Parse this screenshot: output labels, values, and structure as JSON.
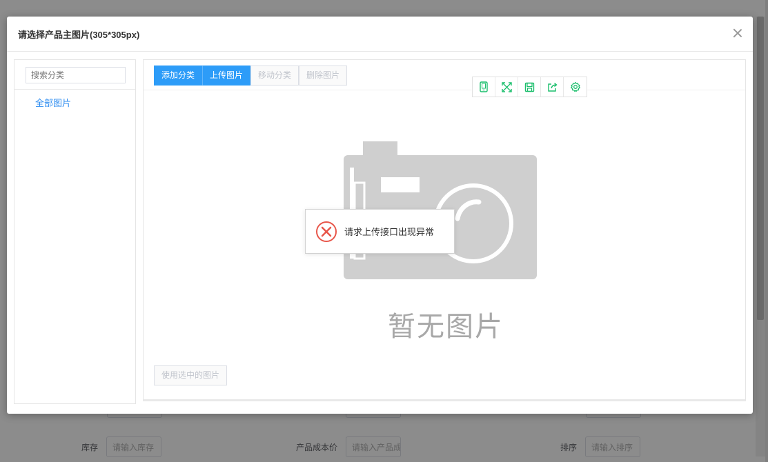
{
  "modal": {
    "title": "请选择产品主图片(305*305px)"
  },
  "sidebar": {
    "search_placeholder": "搜索分类",
    "categories": [
      {
        "label": "全部图片"
      }
    ]
  },
  "toolbar_buttons": {
    "add_category": "添加分类",
    "upload_image": "上传图片",
    "move_category": "移动分类",
    "delete_image": "删除图片"
  },
  "floating_tools": [
    "phone-icon",
    "expand-icon",
    "save-icon",
    "share-icon",
    "settings-icon"
  ],
  "empty_state": {
    "text": "暂无图片"
  },
  "use_selected_label": "使用选中的图片",
  "toast": {
    "message": "请求上传接口出现异常"
  },
  "background_form": {
    "fields": [
      {
        "label": "库存",
        "placeholder": "请输入库存"
      },
      {
        "label": "产品成本价",
        "placeholder": "请输入产品成本价"
      },
      {
        "label": "排序",
        "placeholder": "请输入排序"
      }
    ]
  },
  "colors": {
    "primary": "#2d9cf8",
    "link": "#2d8cf0",
    "error": "#e8564a",
    "tool_green": "#19be6b"
  }
}
